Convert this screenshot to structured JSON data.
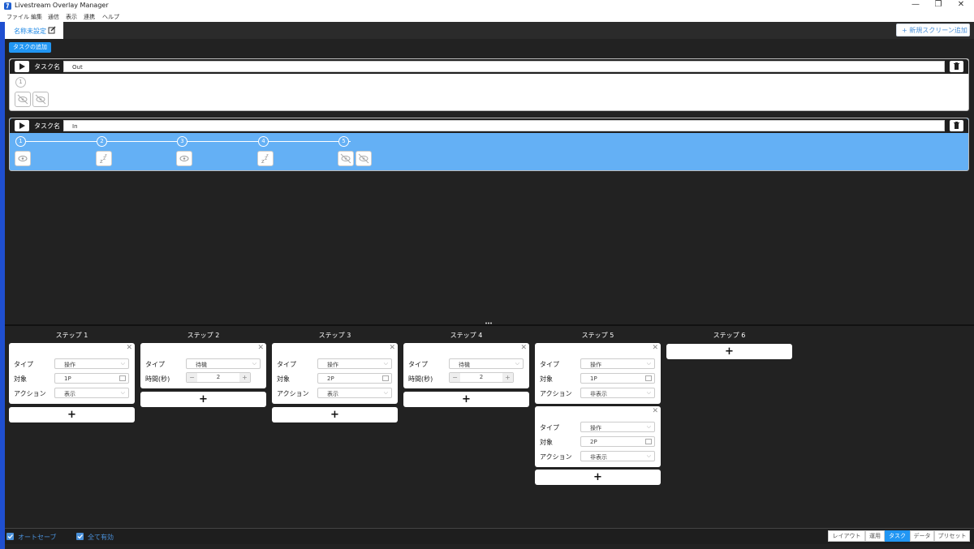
{
  "window": {
    "title": "Livestream Overlay Manager",
    "minimize": "—",
    "restore": "❐",
    "close": "✕"
  },
  "menu": [
    "ファイル",
    "編集",
    "通信",
    "表示",
    "連携",
    "ヘルプ"
  ],
  "screen_tab": {
    "label": "名称未設定"
  },
  "new_screen_button": {
    "label": "+ 新規スクリーン追加"
  },
  "add_task_button": {
    "label": "タスクの追加"
  },
  "tasks": [
    {
      "name_label": "タスク名",
      "name_value": "Out",
      "steps": [
        "1"
      ],
      "icons": [
        [
          "eye-off-icon",
          "eye-off-icon"
        ]
      ]
    },
    {
      "name_label": "タスク名",
      "name_value": "In",
      "steps": [
        "1",
        "2",
        "3",
        "4",
        "5"
      ],
      "icons": [
        [
          "eye-icon"
        ],
        [
          "sleep-icon"
        ],
        [
          "eye-icon"
        ],
        [
          "sleep-icon"
        ],
        [
          "eye-off-icon",
          "eye-off-icon"
        ]
      ]
    }
  ],
  "step_columns": [
    {
      "title": "ステップ 1",
      "add": "+"
    },
    {
      "title": "ステップ 2",
      "add": "+"
    },
    {
      "title": "ステップ 3",
      "add": "+"
    },
    {
      "title": "ステップ 4",
      "add": "+"
    },
    {
      "title": "ステップ 5",
      "add": "+"
    },
    {
      "title": "ステップ 6",
      "add": "+"
    }
  ],
  "labels": {
    "type": "タイプ",
    "target": "対象",
    "action": "アクション",
    "time": "時間(秒)",
    "close": "✕",
    "minus": "−",
    "plus": "+"
  },
  "cards": {
    "s1": {
      "type": "操作",
      "target": "1P",
      "action": "表示"
    },
    "s2": {
      "type": "待機",
      "time": "2"
    },
    "s3": {
      "type": "操作",
      "target": "2P",
      "action": "表示"
    },
    "s4": {
      "type": "待機",
      "time": "2"
    },
    "s5a": {
      "type": "操作",
      "target": "1P",
      "action": "非表示"
    },
    "s5b": {
      "type": "操作",
      "target": "2P",
      "action": "非表示"
    }
  },
  "status": {
    "autosave": "オートセーブ",
    "all_enabled": "全て有効",
    "autosave_checked": true,
    "all_enabled_checked": true
  },
  "mode_tabs": [
    "レイアウト",
    "運用",
    "タスク",
    "データ",
    "プリセット"
  ],
  "active_mode": "タスク",
  "colors": {
    "accent": "#2196f3",
    "selected_task_bg": "#64b0f5",
    "dark_bg": "#222222"
  }
}
